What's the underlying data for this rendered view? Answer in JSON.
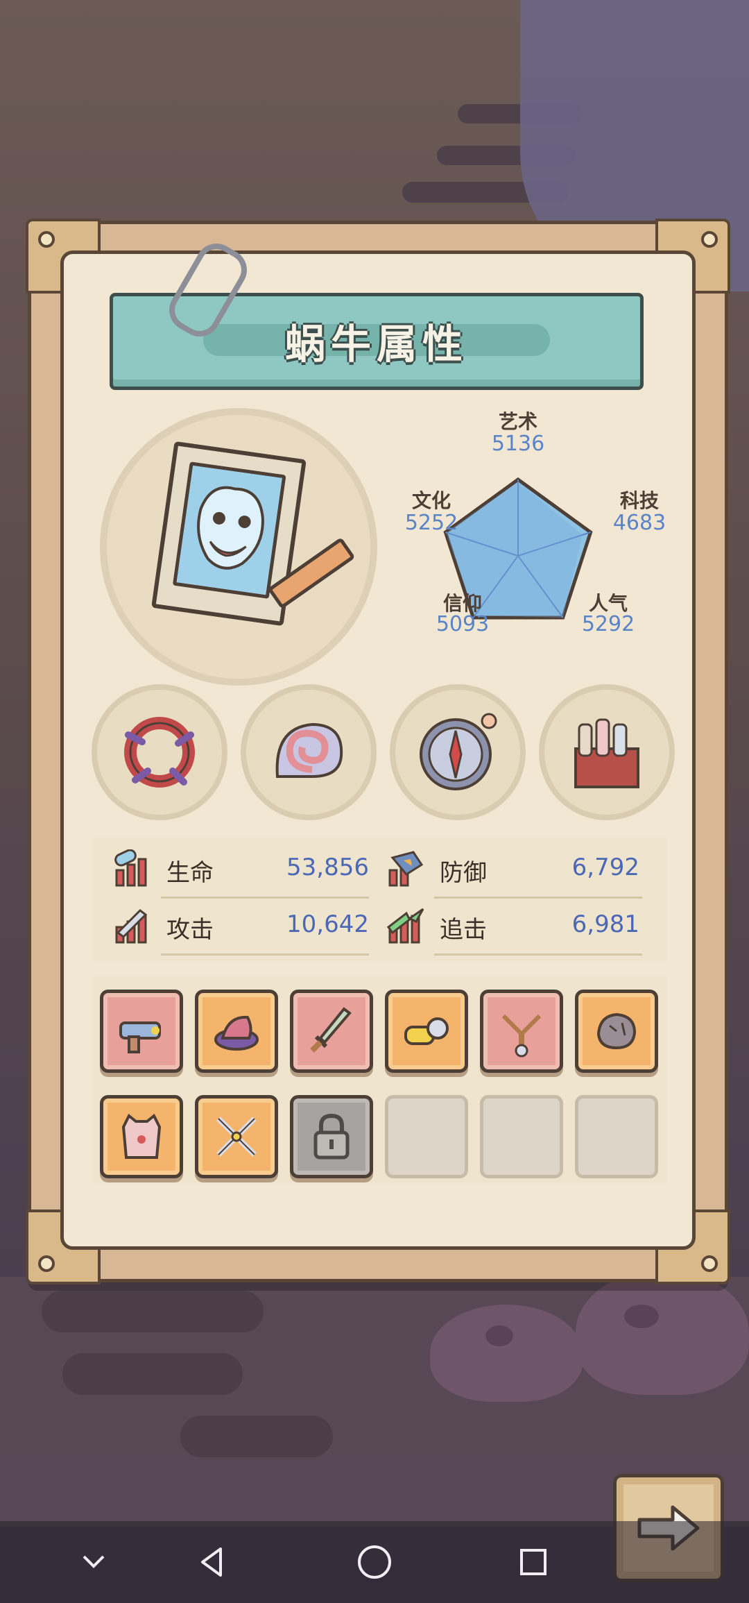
{
  "window": {
    "title": "蜗牛属性"
  },
  "radar_chart": {
    "stats": [
      {
        "key": "art",
        "label": "艺术",
        "value": "5136"
      },
      {
        "key": "tech",
        "label": "科技",
        "value": "4683"
      },
      {
        "key": "popularity",
        "label": "人气",
        "value": "5292"
      },
      {
        "key": "faith",
        "label": "信仰",
        "value": "5093"
      },
      {
        "key": "culture",
        "label": "文化",
        "value": "5252"
      }
    ],
    "fill_color": "#8fc3e3",
    "stroke_color": "#4d3f35"
  },
  "attributes": {
    "hp": {
      "label": "生命",
      "value": "53,856"
    },
    "defense": {
      "label": "防御",
      "value": "6,792"
    },
    "attack": {
      "label": "攻击",
      "value": "10,642"
    },
    "pursuit": {
      "label": "追击",
      "value": "6,981"
    }
  },
  "relics": [
    {
      "icon": "thorn-ring-icon"
    },
    {
      "icon": "snail-shell-icon"
    },
    {
      "icon": "compass-icon"
    },
    {
      "icon": "potion-box-icon"
    }
  ],
  "equipment": {
    "row1": [
      {
        "icon": "blaster-gun-icon",
        "rarity": "red"
      },
      {
        "icon": "feathered-hat-icon",
        "rarity": "orange"
      },
      {
        "icon": "dagger-icon",
        "rarity": "red"
      },
      {
        "icon": "goggles-icon",
        "rarity": "orange"
      },
      {
        "icon": "slingshot-icon",
        "rarity": "red"
      },
      {
        "icon": "ore-rock-icon",
        "rarity": "orange"
      }
    ],
    "row2": [
      {
        "icon": "vest-armor-icon",
        "rarity": "orange"
      },
      {
        "icon": "crossed-swords-icon",
        "rarity": "orange"
      },
      {
        "icon": "lock-icon",
        "rarity": "locked"
      },
      {
        "icon": "",
        "rarity": "empty"
      },
      {
        "icon": "",
        "rarity": "empty"
      },
      {
        "icon": "",
        "rarity": "empty"
      }
    ]
  },
  "colors": {
    "panel_bg": "#f1e7d3",
    "title_bar": "#8fc8c2",
    "stat_value": "#4a68b5",
    "slot_red": "#e7a19a",
    "slot_orange": "#f5b46c"
  },
  "navigation": [
    "chevron-down-icon",
    "back-triangle-icon",
    "home-circle-icon",
    "recents-square-icon"
  ]
}
